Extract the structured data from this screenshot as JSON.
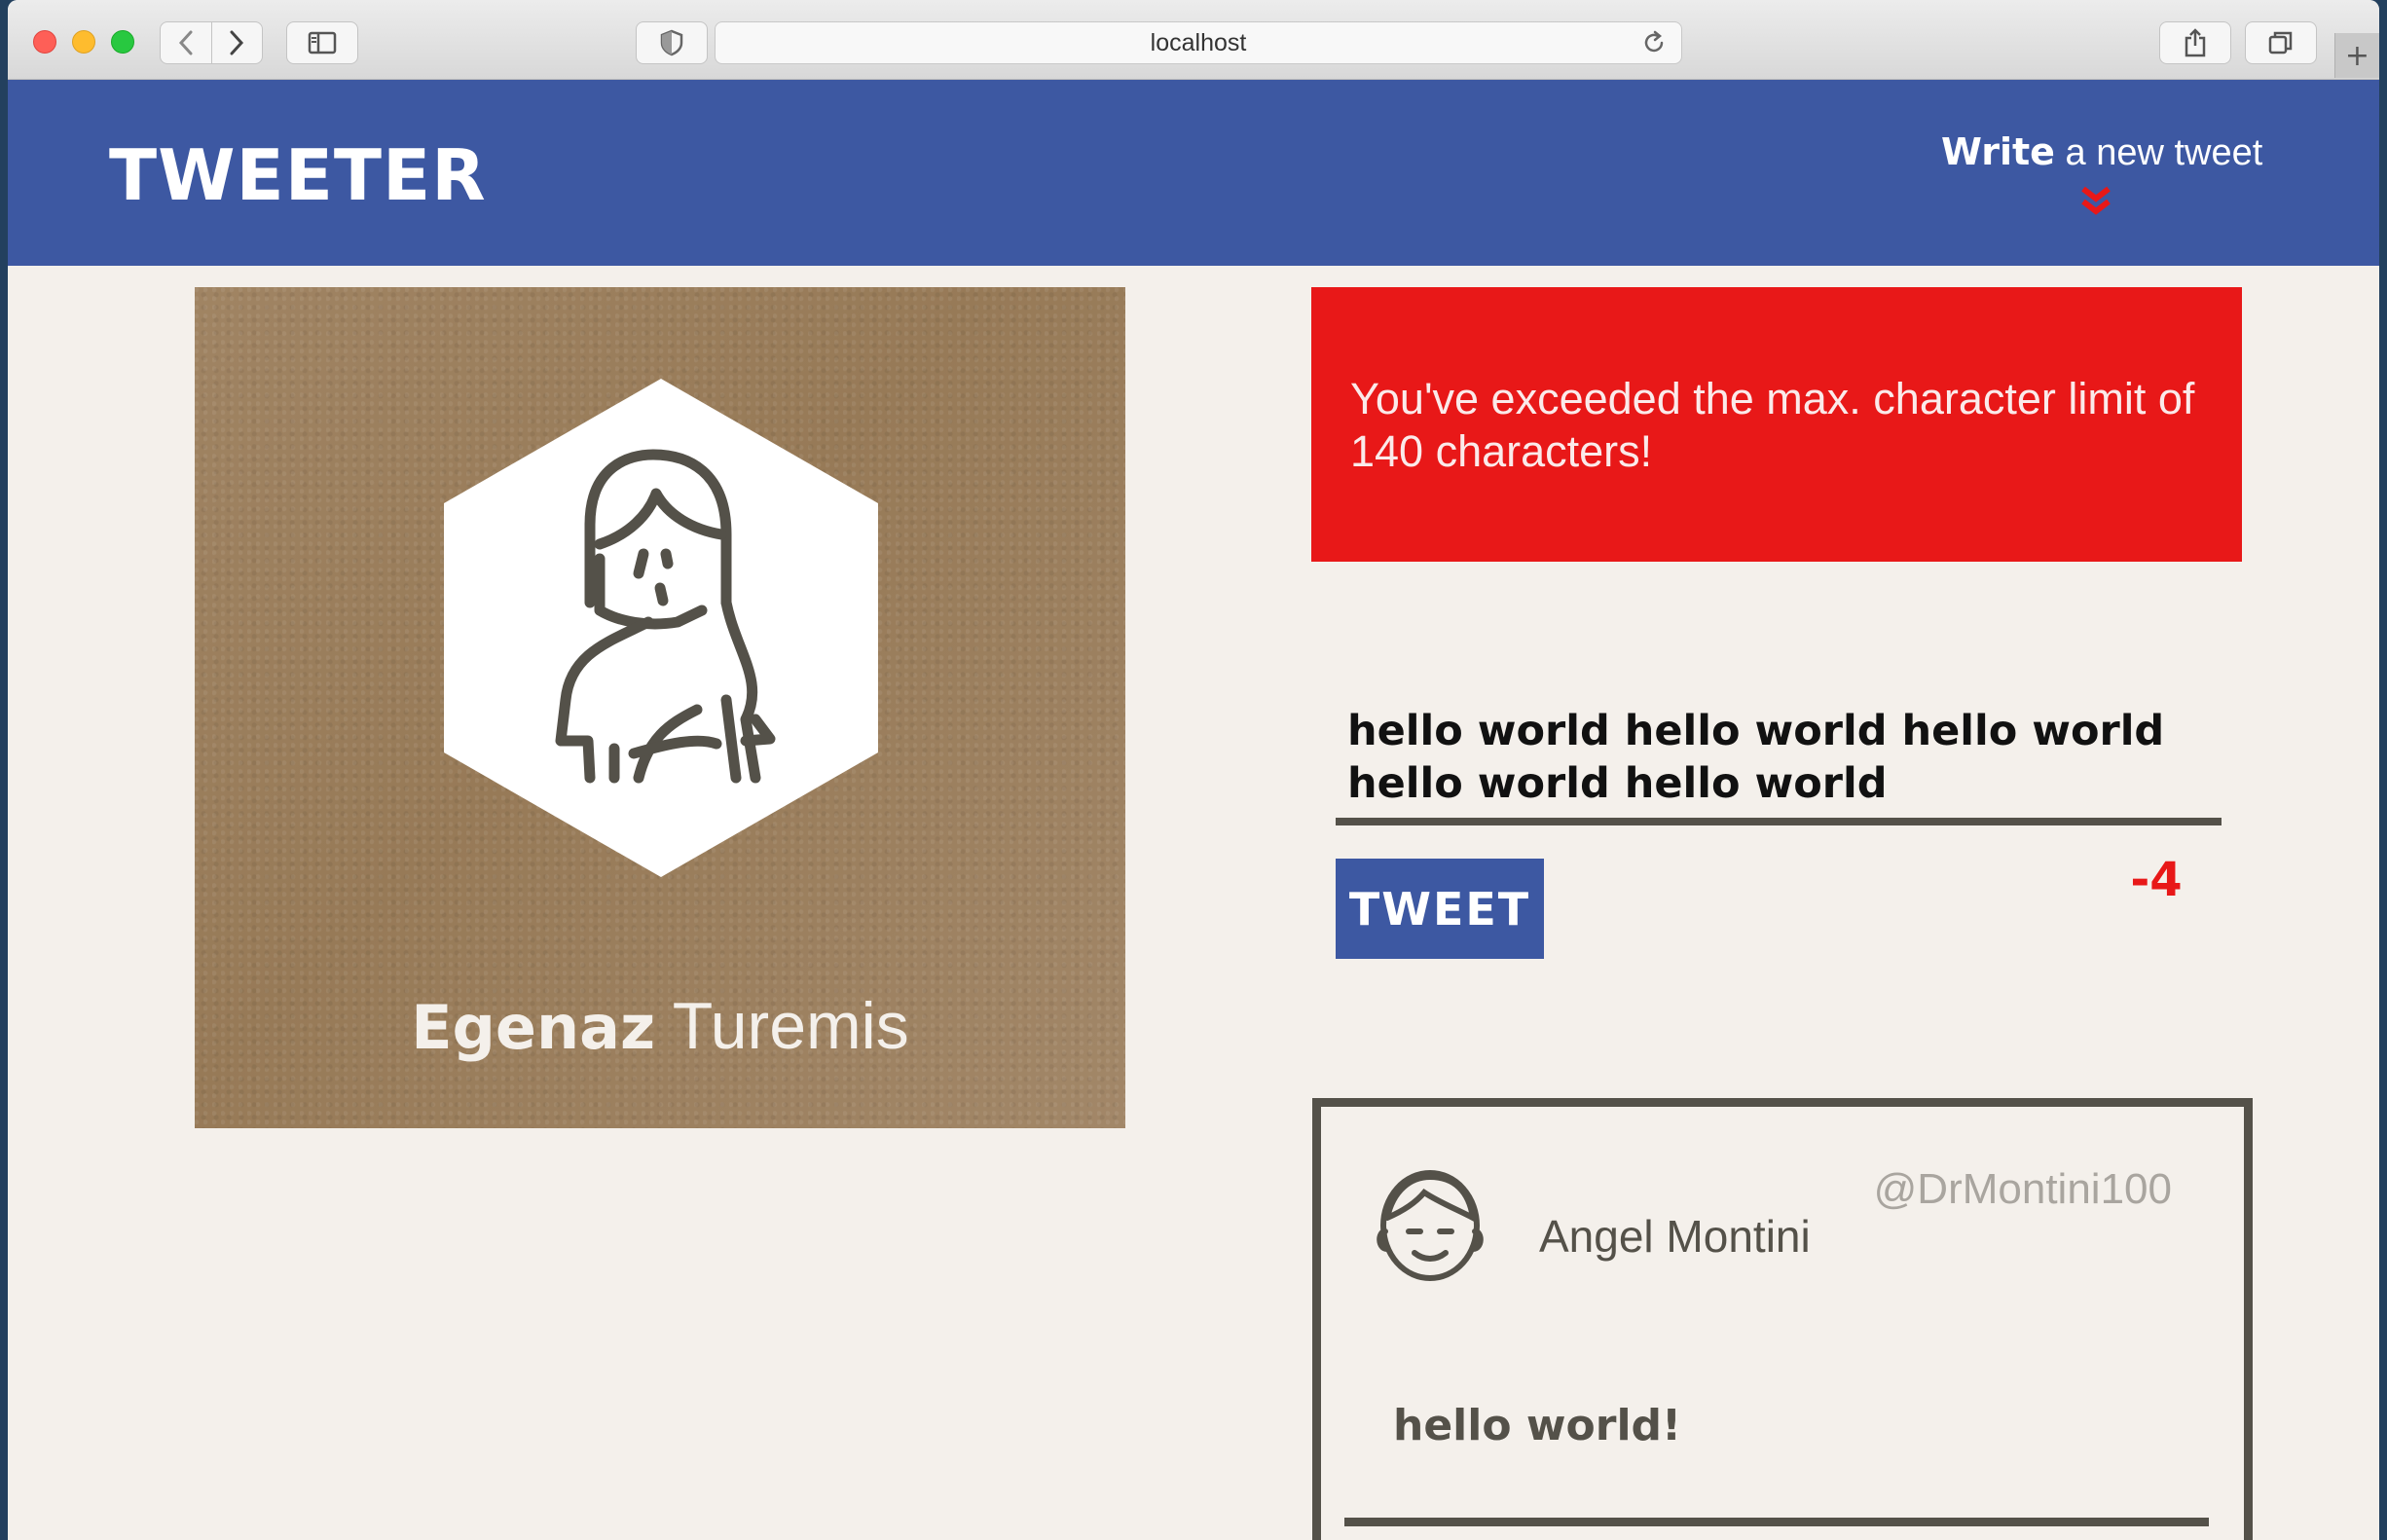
{
  "browser": {
    "url": "localhost",
    "icons": {
      "back": "chevron-left-icon",
      "forward": "chevron-right-icon",
      "sidebar": "sidebar-icon",
      "privacy": "shield-icon",
      "reload": "reload-icon",
      "share": "share-icon",
      "tabs": "tabs-overview-icon",
      "new_tab": "plus-icon"
    }
  },
  "header": {
    "logo": "TWEETER",
    "compose_bold": "Write",
    "compose_rest": " a new tweet"
  },
  "profile": {
    "first_name": "Egenaz",
    "last_name": " Turemis"
  },
  "composer": {
    "error": "You've exceeded the max. character limit of 140 characters!",
    "text": "hello world hello world hello world hello world hello world",
    "button": "TWEET",
    "counter": "-4"
  },
  "tweets": [
    {
      "name": "Angel Montini",
      "handle": "@DrMontini100",
      "text": "hello world!"
    }
  ],
  "colors": {
    "header": "#3d58a2",
    "error": "#e81818",
    "page_bg": "#f4f0eb",
    "dark": "#545149"
  }
}
